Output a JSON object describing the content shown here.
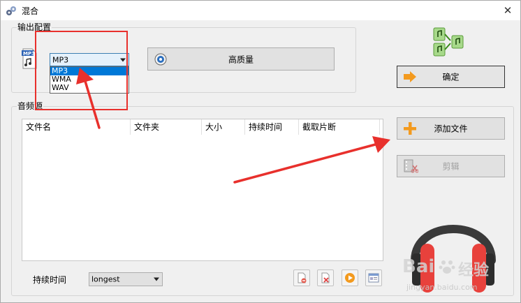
{
  "window": {
    "title": "混合",
    "close_glyph": "✕"
  },
  "output": {
    "legend": "输出配置",
    "format_combo_value": "MP3",
    "format_options": [
      "MP3",
      "WMA",
      "WAV"
    ],
    "selected_option_index": 0,
    "quality_button": "高质量"
  },
  "confirm_button": "确定",
  "audio": {
    "legend": "音频源",
    "columns": [
      "文件名",
      "文件夹",
      "大小",
      "持续时间",
      "截取片断"
    ],
    "add_file_button": "添加文件",
    "cut_button": "剪辑",
    "duration_label": "持续时间",
    "duration_value": "longest"
  },
  "watermark": {
    "brand": "Bai",
    "brand_cn": "经验",
    "url": "jingyan.baidu.com"
  },
  "colors": {
    "annotation_red": "#e8302c",
    "accent_orange": "#f39a1e",
    "headphone_red": "#e8413c",
    "selection_blue": "#0078d7"
  }
}
